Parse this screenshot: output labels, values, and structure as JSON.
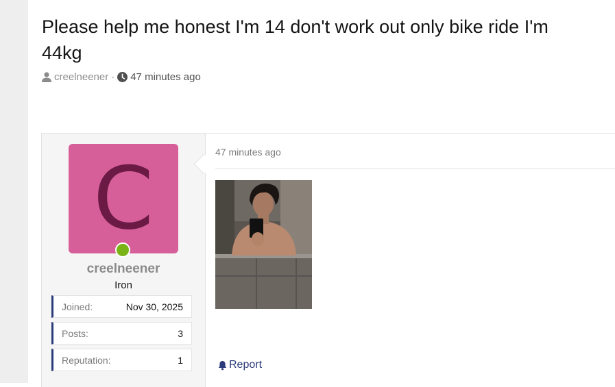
{
  "thread": {
    "title": "Please help me honest I'm 14 don't work out only bike ride I'm 44kg",
    "author": "creelneener",
    "separator": "·",
    "time": "47 minutes ago",
    "author_icon": "user-icon",
    "time_icon": "clock-icon"
  },
  "post": {
    "user": {
      "avatar_letter": "C",
      "avatar_color": "#d65f9a",
      "avatar_letter_color": "#6b1a45",
      "online_status": "online",
      "online_color": "#7ab317",
      "username": "creelneener",
      "title": "Iron",
      "stats": [
        {
          "label": "Joined:",
          "value": "Nov 30, 2025"
        },
        {
          "label": "Posts:",
          "value": "3"
        },
        {
          "label": "Reputation:",
          "value": "1"
        }
      ]
    },
    "date": "47 minutes ago",
    "attachment_icon": "photo-attachment",
    "report_label": "Report",
    "report_icon": "bell-icon"
  },
  "colors": {
    "accent": "#2a3a7a",
    "gutter": "#eeeeee",
    "user_panel": "#f5f5f5"
  }
}
